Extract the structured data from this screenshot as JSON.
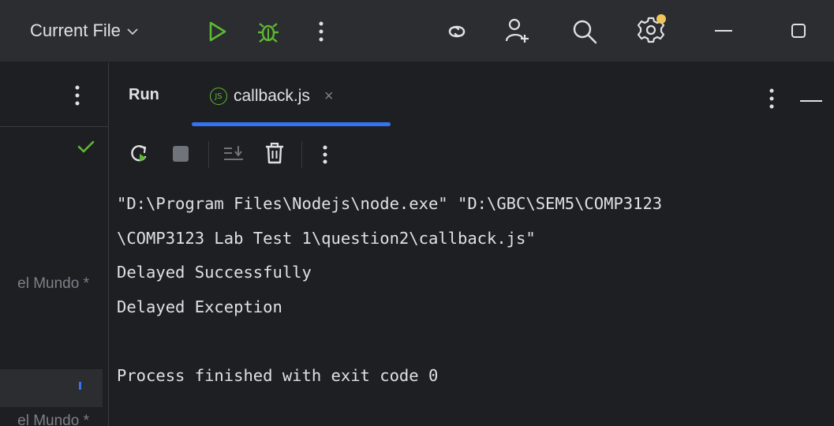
{
  "titlebar": {
    "run_config": "Current File",
    "icons": [
      "chevron-down-icon",
      "run-icon",
      "debug-icon",
      "more-vertical-icon",
      "ai-assistant-icon",
      "add-user-icon",
      "search-icon",
      "settings-icon",
      "minimize-icon",
      "maximize-icon"
    ],
    "colors": {
      "run": "#5fb832",
      "debug": "#5fb832",
      "settings_badge": "#f2c55c"
    }
  },
  "left_panel": {
    "items": [
      {
        "text": "el Mundo *"
      },
      {
        "text": "el Mundo *"
      }
    ]
  },
  "run_panel": {
    "title": "Run",
    "tab": {
      "label": "callback.js",
      "icon": "nodejs-icon",
      "close": "×"
    },
    "toolbar": [
      "rerun-icon",
      "stop-icon",
      "scroll-to-end-icon",
      "clear-all-icon",
      "more-vertical-icon"
    ],
    "accent": "#3574f0",
    "console_lines": [
      "\"D:\\Program Files\\Nodejs\\node.exe\" \"D:\\GBC\\SEM5\\COMP3123",
      "\\COMP3123 Lab Test 1\\question2\\callback.js\"",
      "Delayed Successfully",
      "Delayed Exception",
      "",
      "Process finished with exit code 0"
    ]
  }
}
